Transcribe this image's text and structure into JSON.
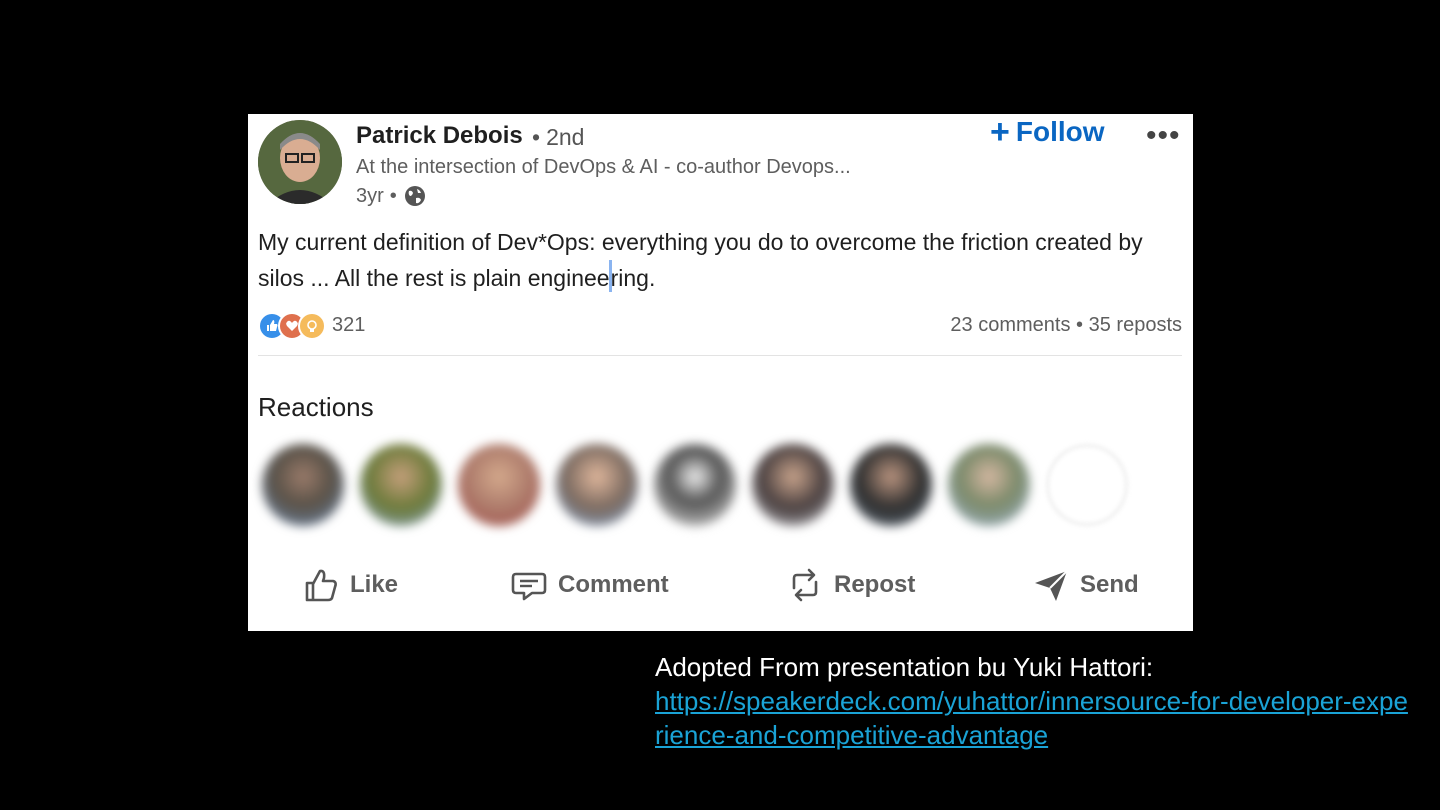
{
  "post": {
    "author": {
      "name": "Patrick Debois",
      "degree": "2nd",
      "headline": "At the intersection of DevOps & AI - co-author Devops...",
      "age": "3yr"
    },
    "follow_label": "Follow",
    "more_label": "•••",
    "text_part1": "My current definition of Dev*Ops: everything you do to overcome the friction created by silos ... All the rest is plain enginee",
    "text_part2": "ring.",
    "reaction_count": "321",
    "comments": "23 comments",
    "reposts": "35 reposts",
    "reactions_heading": "Reactions",
    "actions": {
      "like": "Like",
      "comment": "Comment",
      "repost": "Repost",
      "send": "Send"
    }
  },
  "caption": {
    "text": "Adopted From presentation bu Yuki Hattori:",
    "link": "https://speakerdeck.com/yuhattor/innersource-for-developer-experience-and-competitive-advantage"
  },
  "colors": {
    "background": "#000000",
    "card": "#ffffff",
    "accent": "#0a66c2",
    "link": "#1aa3d6"
  }
}
